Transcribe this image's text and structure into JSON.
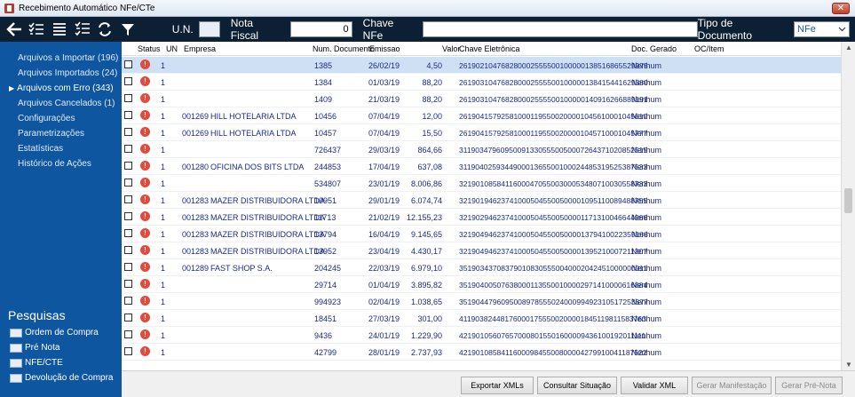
{
  "window": {
    "title": "Recebimento Automático NFe/CTe",
    "close_glyph": "✕"
  },
  "toolbar": {
    "un_label": "U.N.",
    "un_value": "",
    "nota_label": "Nota Fiscal",
    "nota_value": "0",
    "chave_label": "Chave NFe",
    "chave_value": "",
    "tipo_label": "Tipo de Documento",
    "tipo_value": "NFe"
  },
  "sidebar": {
    "items": [
      {
        "label": "Arquivos a Importar (196)"
      },
      {
        "label": "Arquivos Importados (24)"
      },
      {
        "label": "Arquivos com Erro (343)"
      },
      {
        "label": "Arquivos Cancelados (1)"
      },
      {
        "label": "Configurações"
      },
      {
        "label": "Parametrizações"
      },
      {
        "label": "Estatísticas"
      },
      {
        "label": "Histórico de Ações"
      }
    ],
    "active_arrow": "▶",
    "pesquisas_title": "Pesquisas",
    "pesquisas": [
      {
        "label": "Ordem de Compra"
      },
      {
        "label": "Pré Nota"
      },
      {
        "label": "NFE/CTE"
      },
      {
        "label": "Devolução de Compra"
      }
    ]
  },
  "grid": {
    "headers": {
      "status": "Status",
      "un": "UN",
      "empresa": "Empresa",
      "num": "Num. Documento",
      "emissao": "Emissao",
      "valor": "Valor",
      "chave": "Chave Eletrônica",
      "doc": "Doc. Gerado",
      "oc": "OC/Item"
    },
    "rows": [
      {
        "un": "1",
        "cod": "",
        "empresa": "",
        "num": "1385",
        "emissao": "26/02/19",
        "valor": "4,50",
        "chave": "261902104768280002555500100000138516865529975",
        "doc": "Nenhum"
      },
      {
        "un": "1",
        "cod": "",
        "empresa": "",
        "num": "1384",
        "emissao": "01/03/19",
        "valor": "88,20",
        "chave": "261903104768280002555500100000138415441629380",
        "doc": "Nenhum"
      },
      {
        "un": "1",
        "cod": "",
        "empresa": "",
        "num": "1409",
        "emissao": "21/03/19",
        "valor": "88,20",
        "chave": "261903104768280002555500100000140916266889191",
        "doc": "Nenhum"
      },
      {
        "un": "1",
        "cod": "001269",
        "empresa": "HILL HOTELARIA LTDA",
        "num": "10456",
        "emissao": "07/04/19",
        "valor": "12,00",
        "chave": "261904157925810001195500200001045610001045610",
        "doc": "Nenhum"
      },
      {
        "un": "1",
        "cod": "001269",
        "empresa": "HILL HOTELARIA LTDA",
        "num": "10457",
        "emissao": "07/04/19",
        "valor": "15,50",
        "chave": "261904157925810001195500200001045710001045777",
        "doc": "Nenhum"
      },
      {
        "un": "1",
        "cod": "",
        "empresa": "",
        "num": "726437",
        "emissao": "29/03/19",
        "valor": "864,66",
        "chave": "311903479609500913305550050007264371020852515",
        "doc": "Nenhum"
      },
      {
        "un": "1",
        "cod": "001280",
        "empresa": "OFICINA DOS BITS LTDA",
        "num": "244853",
        "emissao": "17/04/19",
        "valor": "637,08",
        "chave": "311904025934490001365500100024485319525387533",
        "doc": "Nenhum"
      },
      {
        "un": "1",
        "cod": "",
        "empresa": "",
        "num": "534807",
        "emissao": "23/01/19",
        "valor": "8.006,86",
        "chave": "321901085841160004705500300053480710030558733",
        "doc": "Nenhum"
      },
      {
        "un": "1",
        "cod": "001283",
        "empresa": "MAZER DISTRIBUIDORA LTDA",
        "num": "10951",
        "emissao": "29/01/19",
        "valor": "6.074,74",
        "chave": "321901946237410005045500500001095110089488755",
        "doc": "Nenhum"
      },
      {
        "un": "1",
        "cod": "001283",
        "empresa": "MAZER DISTRIBUIDORA LTDA",
        "num": "11713",
        "emissao": "21/02/19",
        "valor": "12.155,23",
        "chave": "321902946237410005045500500001171310046644966",
        "doc": "Nenhum"
      },
      {
        "un": "1",
        "cod": "001283",
        "empresa": "MAZER DISTRIBUIDORA LTDA",
        "num": "13794",
        "emissao": "16/04/19",
        "valor": "9.145,65",
        "chave": "321904946237410005045500500001379410022359166",
        "doc": "Nenhum"
      },
      {
        "un": "1",
        "cod": "001283",
        "empresa": "MAZER DISTRIBUIDORA LTDA",
        "num": "13952",
        "emissao": "23/04/19",
        "valor": "4.430,17",
        "chave": "321904946237410005045500500001395210007211307",
        "doc": "Nenhum"
      },
      {
        "un": "1",
        "cod": "001289",
        "empresa": "FAST SHOP S.A.",
        "num": "204245",
        "emissao": "22/03/19",
        "valor": "6.979,10",
        "chave": "351903437083790108305550040002042451000000011",
        "doc": "Nenhum"
      },
      {
        "un": "1",
        "cod": "",
        "empresa": "",
        "num": "29714",
        "emissao": "01/04/19",
        "valor": "3.895,82",
        "chave": "351904005076380001135500100002971410000616884",
        "doc": "Nenhum"
      },
      {
        "un": "1",
        "cod": "",
        "empresa": "",
        "num": "994923",
        "emissao": "02/04/19",
        "valor": "1.038,65",
        "chave": "351904479609500897855502400099492310517253677",
        "doc": "Nenhum"
      },
      {
        "un": "1",
        "cod": "",
        "empresa": "",
        "num": "18451",
        "emissao": "27/03/19",
        "valor": "301,00",
        "chave": "411903824481760001755500200001845119811583763",
        "doc": "Nenhum"
      },
      {
        "un": "1",
        "cod": "",
        "empresa": "",
        "num": "9436",
        "emissao": "24/01/19",
        "valor": "1.229,90",
        "chave": "421901056076570008015501600009436100192011111",
        "doc": "Nenhum"
      },
      {
        "un": "1",
        "cod": "",
        "empresa": "",
        "num": "42799",
        "emissao": "28/01/19",
        "valor": "2.737,93",
        "chave": "421901085841160009845500800004279910041187522",
        "doc": "Nenhum"
      }
    ]
  },
  "buttons": {
    "exportar": "Exportar XMLs",
    "consultar": "Consultar Situação",
    "validar": "Validar XML",
    "gerar_manifestacao": "Gerar Manifestação",
    "gerar_prenota": "Gerar Pré-Nota"
  },
  "colors": {
    "toolbar_bg": "#0d1f33",
    "sidebar_bg": "#0f56a0",
    "selected_row": "#cde0f4",
    "status_error": "#e24a3b"
  }
}
